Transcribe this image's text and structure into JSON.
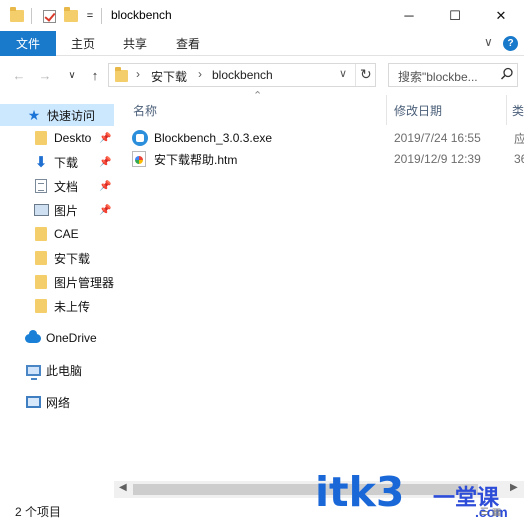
{
  "window": {
    "title": "blockbench",
    "controls": {
      "minimize": "─",
      "maximize": "☐",
      "close": "✕"
    },
    "qa_sep": "="
  },
  "ribbon": {
    "file_tab": "文件",
    "tabs": [
      "主页",
      "共享",
      "查看"
    ],
    "expand": "∨",
    "help": "?"
  },
  "nav": {
    "back": "←",
    "forward": "→",
    "recent": "∨",
    "up": "↑"
  },
  "address": {
    "segments": [
      "安下载",
      "blockbench"
    ],
    "separator": "›",
    "dropdown": "∨",
    "refresh": "↻"
  },
  "search": {
    "placeholder": "搜索\"blockbe..."
  },
  "navpane": {
    "quick_access": "快速访问",
    "items": [
      {
        "label": "Deskto",
        "pinned": true,
        "icon": "folder-icon"
      },
      {
        "label": "下载",
        "pinned": true,
        "icon": "download-arrow-icon"
      },
      {
        "label": "文档",
        "pinned": true,
        "icon": "document-icon"
      },
      {
        "label": "图片",
        "pinned": true,
        "icon": "picture-icon"
      },
      {
        "label": "CAE",
        "pinned": false,
        "icon": "folder-icon"
      },
      {
        "label": "安下载",
        "pinned": false,
        "icon": "folder-icon"
      },
      {
        "label": "图片管理器",
        "pinned": false,
        "icon": "folder-icon"
      },
      {
        "label": "未上传",
        "pinned": false,
        "icon": "folder-icon"
      }
    ],
    "onedrive": "OneDrive",
    "this_pc": "此电脑",
    "network": "网络",
    "pin_glyph": "📌"
  },
  "columns": {
    "name": "名称",
    "date": "修改日期",
    "type": "类"
  },
  "files": [
    {
      "name": "Blockbench_3.0.3.exe",
      "date": "2019/7/24 16:55",
      "type": "应",
      "icon": "exe-icon"
    },
    {
      "name": "安下载帮助.htm",
      "date": "2019/12/9 12:39",
      "type": "36",
      "icon": "html-file-icon"
    }
  ],
  "status": {
    "count": "2 个项目"
  },
  "watermark": {
    "main": "itk3",
    "cn": "一堂课",
    "com": ".com"
  }
}
